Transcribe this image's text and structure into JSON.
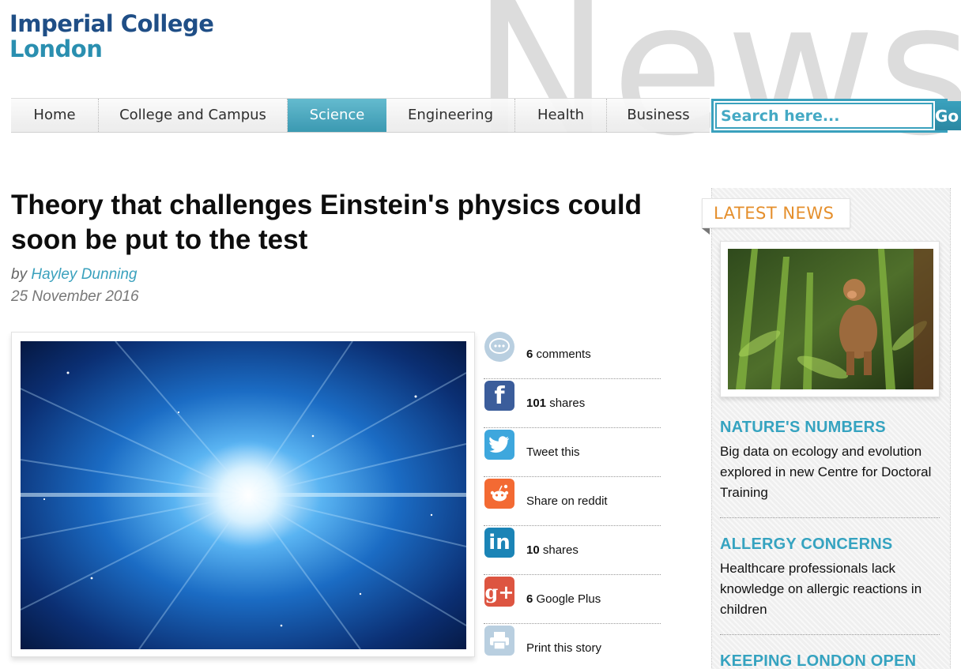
{
  "logo": {
    "line1": "Imperial College",
    "line2": "London"
  },
  "watermark": "News",
  "nav": {
    "items": [
      {
        "label": "Home"
      },
      {
        "label": "College and Campus"
      },
      {
        "label": "Science",
        "active": true
      },
      {
        "label": "Engineering"
      },
      {
        "label": "Health"
      },
      {
        "label": "Business"
      }
    ]
  },
  "search": {
    "placeholder": "Search here...",
    "button": "Go"
  },
  "article": {
    "title": "Theory that challenges Einstein's physics could soon be put to the test",
    "by": "by",
    "author": "Hayley Dunning",
    "date": "25 November 2016"
  },
  "share": [
    {
      "icon": "comment-icon",
      "count": "6",
      "text": "comments",
      "color": "#b9cfe0"
    },
    {
      "icon": "facebook-icon",
      "count": "101",
      "text": "shares",
      "color": "#3b5d9b"
    },
    {
      "icon": "twitter-icon",
      "count": "",
      "text": "Tweet this",
      "color": "#3ea7dd"
    },
    {
      "icon": "reddit-icon",
      "count": "",
      "text": "Share on reddit",
      "color": "#f36a33"
    },
    {
      "icon": "linkedin-icon",
      "count": "10",
      "text": "shares",
      "color": "#1b84b6"
    },
    {
      "icon": "google-plus-icon",
      "count": "6",
      "text": "Google Plus",
      "color": "#dd5541"
    },
    {
      "icon": "print-icon",
      "count": "",
      "text": "Print this story",
      "color": "#b9cfe0"
    }
  ],
  "sidebar": {
    "heading": "LATEST NEWS",
    "stories": [
      {
        "title": "NATURE'S NUMBERS",
        "desc": "Big data on ecology and evolution explored in new Centre for Doctoral Training"
      },
      {
        "title": "ALLERGY CONCERNS",
        "desc": "Healthcare professionals lack knowledge on allergic reactions in children"
      },
      {
        "title": "KEEPING LONDON OPEN",
        "desc": ""
      }
    ]
  },
  "colors": {
    "accent": "#3aa1bd",
    "brand": "#1f4e86",
    "latest": "#e58f2c"
  }
}
